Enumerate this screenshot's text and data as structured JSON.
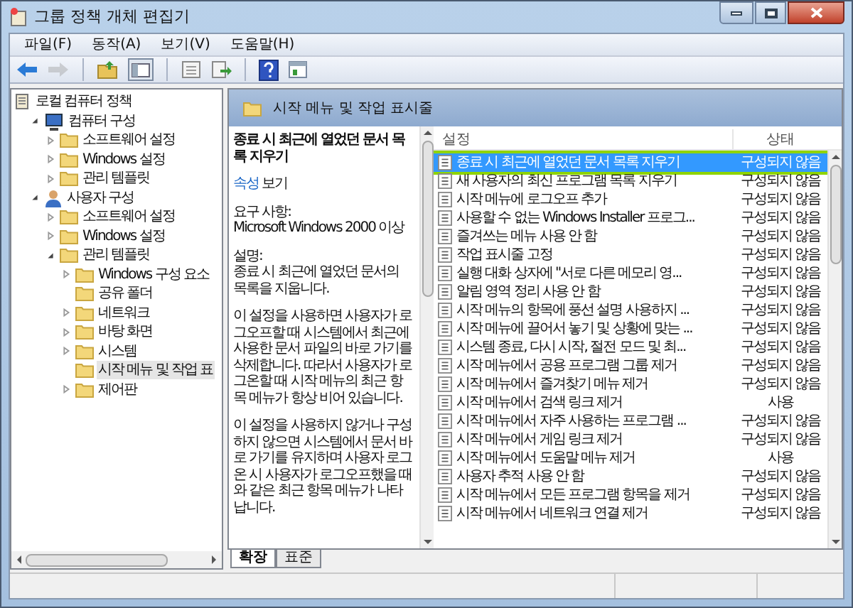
{
  "window": {
    "title": "그룹 정책 개체 편집기"
  },
  "menu": [
    "파일(F)",
    "동작(A)",
    "보기(V)",
    "도움말(H)"
  ],
  "toolbar": [
    {
      "kind": "back",
      "disabled": false
    },
    {
      "kind": "forward",
      "disabled": true
    },
    {
      "kind": "sep"
    },
    {
      "kind": "up",
      "disabled": false
    },
    {
      "kind": "tree",
      "disabled": false
    },
    {
      "kind": "sep"
    },
    {
      "kind": "export",
      "disabled": false
    },
    {
      "kind": "export2",
      "disabled": false
    },
    {
      "kind": "sep"
    },
    {
      "kind": "help",
      "disabled": false
    },
    {
      "kind": "pane",
      "disabled": false
    }
  ],
  "tree": [
    {
      "label": "로컬 컴퓨터 정책",
      "kind": "policy",
      "selected": false,
      "children": [
        {
          "label": "컴퓨터 구성",
          "kind": "computer",
          "selected": false,
          "expanded": true,
          "children": [
            {
              "label": "소프트웨어 설정",
              "kind": "folder",
              "selected": false,
              "expanded": false
            },
            {
              "label": "Windows 설정",
              "kind": "folder",
              "selected": false,
              "expanded": false
            },
            {
              "label": "관리 템플릿",
              "kind": "folder",
              "selected": false,
              "expanded": false
            }
          ]
        },
        {
          "label": "사용자 구성",
          "kind": "user",
          "selected": false,
          "expanded": true,
          "children": [
            {
              "label": "소프트웨어 설정",
              "kind": "folder",
              "selected": false,
              "expanded": false
            },
            {
              "label": "Windows 설정",
              "kind": "folder",
              "selected": false,
              "expanded": false
            },
            {
              "label": "관리 템플릿",
              "kind": "folder",
              "selected": false,
              "expanded": true,
              "children": [
                {
                  "label": "Windows 구성 요소",
                  "kind": "folder",
                  "selected": false,
                  "expanded": false
                },
                {
                  "label": "공유 폴더",
                  "kind": "folder",
                  "selected": false
                },
                {
                  "label": "네트워크",
                  "kind": "folder",
                  "selected": false,
                  "expanded": false
                },
                {
                  "label": "바탕 화면",
                  "kind": "folder",
                  "selected": false,
                  "expanded": false
                },
                {
                  "label": "시스템",
                  "kind": "folder",
                  "selected": false,
                  "expanded": false
                },
                {
                  "label": "시작 메뉴 및 작업 표",
                  "kind": "folder",
                  "selected": true
                },
                {
                  "label": "제어판",
                  "kind": "folder",
                  "selected": false,
                  "expanded": false
                }
              ]
            }
          ]
        }
      ]
    }
  ],
  "header": {
    "title": "시작 메뉴 및 작업 표시줄"
  },
  "description": {
    "title": "종료 시 최근에 열었던 문서 목록 지우기",
    "link": "속성",
    "link_after": "보기",
    "requirements_label": "요구 사항:",
    "requirements": "Microsoft Windows 2000 이상",
    "description_label": "설명:",
    "paragraphs": [
      "종료 시 최근에 열었던 문서의 목록을 지웁니다.",
      "이 설정을 사용하면 사용자가 로그오프할 때 시스템에서 최근에 사용한 문서 파일의 바로 가기를 삭제합니다. 따라서 사용자가 로그온할 때 시작 메뉴의 최근 항목 메뉴가 항상 비어 있습니다.",
      "이 설정을 사용하지 않거나 구성하지 않으면 시스템에서 문서 바로 가기를 유지하며 사용자 로그온 시 사용자가 로그오프했을 때와 같은 최근 항목 메뉴가 나타납니다."
    ]
  },
  "table": {
    "columns": [
      "설정",
      "상태"
    ],
    "rows": [
      {
        "name": "종료 시 최근에 열었던 문서 목록 지우기",
        "state": "구성되지 않음",
        "selected": true,
        "outlined": true
      },
      {
        "name": "새 사용자의 최신 프로그램 목록 지우기",
        "state": "구성되지 않음",
        "selected": false,
        "outlined": false
      },
      {
        "name": "시작 메뉴에 로그오프 추가",
        "state": "구성되지 않음",
        "selected": false,
        "outlined": false
      },
      {
        "name": "사용할 수 없는 Windows Installer 프로그...",
        "state": "구성되지 않음",
        "selected": false,
        "outlined": false
      },
      {
        "name": "즐겨쓰는 메뉴 사용 안 함",
        "state": "구성되지 않음",
        "selected": false,
        "outlined": false
      },
      {
        "name": "작업 표시줄 고정",
        "state": "구성되지 않음",
        "selected": false,
        "outlined": false
      },
      {
        "name": "실행 대화 상자에 \"서로 다른 메모리 영...",
        "state": "구성되지 않음",
        "selected": false,
        "outlined": false
      },
      {
        "name": "알림 영역 정리 사용 안 함",
        "state": "구성되지 않음",
        "selected": false,
        "outlined": false
      },
      {
        "name": "시작 메뉴의 항목에 풍선 설명 사용하지 ...",
        "state": "구성되지 않음",
        "selected": false,
        "outlined": false
      },
      {
        "name": "시작 메뉴에 끌어서 놓기 및 상황에 맞는 ...",
        "state": "구성되지 않음",
        "selected": false,
        "outlined": false
      },
      {
        "name": "시스템 종료, 다시 시작, 절전 모드 및 최...",
        "state": "구성되지 않음",
        "selected": false,
        "outlined": false
      },
      {
        "name": "시작 메뉴에서 공용 프로그램 그룹 제거",
        "state": "구성되지 않음",
        "selected": false,
        "outlined": false
      },
      {
        "name": "시작 메뉴에서 즐겨찾기 메뉴 제거",
        "state": "구성되지 않음",
        "selected": false,
        "outlined": false
      },
      {
        "name": "시작 메뉴에서 검색 링크 제거",
        "state": "사용",
        "selected": false,
        "outlined": false
      },
      {
        "name": "시작 메뉴에서 자주 사용하는 프로그램 ...",
        "state": "구성되지 않음",
        "selected": false,
        "outlined": false
      },
      {
        "name": "시작 메뉴에서 게임 링크 제거",
        "state": "구성되지 않음",
        "selected": false,
        "outlined": false
      },
      {
        "name": "시작 메뉴에서 도움말 메뉴 제거",
        "state": "사용",
        "selected": false,
        "outlined": false
      },
      {
        "name": "사용자 추적 사용 안 함",
        "state": "구성되지 않음",
        "selected": false,
        "outlined": false
      },
      {
        "name": "시작 메뉴에서 모든 프로그램 항목을 제거",
        "state": "구성되지 않음",
        "selected": false,
        "outlined": false
      },
      {
        "name": "시작 메뉴에서 네트워크 연결 제거",
        "state": "구성되지 않음",
        "selected": false,
        "outlined": false
      }
    ]
  },
  "view_tabs": [
    {
      "label": "확장",
      "selected": true
    },
    {
      "label": "표준",
      "selected": false
    }
  ]
}
